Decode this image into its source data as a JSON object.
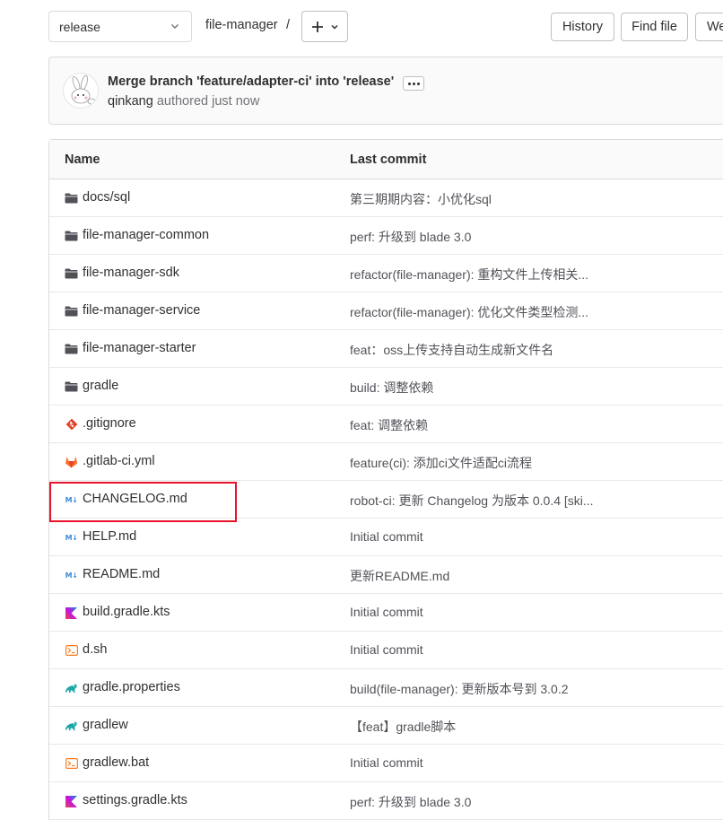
{
  "topbar": {
    "branch": "release",
    "breadcrumb": "file-manager",
    "breadcrumb_sep": "/",
    "history_label": "History",
    "find_file_label": "Find file",
    "web_ide_label": "Web IDE"
  },
  "commit": {
    "title": "Merge branch 'feature/adapter-ci' into 'release'",
    "author": "qinkang",
    "time": " authored just now"
  },
  "table": {
    "col_name": "Name",
    "col_last_commit": "Last commit",
    "rows": [
      {
        "name": "docs/sql",
        "icon": "folder-icon",
        "commit": "第三期期内容：小优化sql"
      },
      {
        "name": "file-manager-common",
        "icon": "folder-icon",
        "commit": "perf: 升级到 blade 3.0"
      },
      {
        "name": "file-manager-sdk",
        "icon": "folder-icon",
        "commit": "refactor(file-manager): 重构文件上传相关..."
      },
      {
        "name": "file-manager-service",
        "icon": "folder-icon",
        "commit": "refactor(file-manager): 优化文件类型检测..."
      },
      {
        "name": "file-manager-starter",
        "icon": "folder-icon",
        "commit": "feat：oss上传支持自动生成新文件名"
      },
      {
        "name": "gradle",
        "icon": "folder-icon",
        "commit": "build: 调整依赖"
      },
      {
        "name": ".gitignore",
        "icon": "git-icon",
        "commit": "feat: 调整依赖"
      },
      {
        "name": ".gitlab-ci.yml",
        "icon": "gitlab-icon",
        "commit": "feature(ci): 添加ci文件适配ci流程"
      },
      {
        "name": "CHANGELOG.md",
        "icon": "markdown-icon",
        "commit": "robot-ci: 更新 Changelog 为版本 0.0.4 [ski..."
      },
      {
        "name": "HELP.md",
        "icon": "markdown-icon",
        "commit": "Initial commit"
      },
      {
        "name": "README.md",
        "icon": "markdown-icon",
        "commit": "更新README.md"
      },
      {
        "name": "build.gradle.kts",
        "icon": "kotlin-icon",
        "commit": "Initial commit"
      },
      {
        "name": "d.sh",
        "icon": "terminal-icon",
        "commit": "Initial commit"
      },
      {
        "name": "gradle.properties",
        "icon": "gradle-icon",
        "commit": "build(file-manager): 更新版本号到 3.0.2"
      },
      {
        "name": "gradlew",
        "icon": "gradle-icon",
        "commit": "【feat】gradle脚本"
      },
      {
        "name": "gradlew.bat",
        "icon": "terminal-icon",
        "commit": "Initial commit"
      },
      {
        "name": "settings.gradle.kts",
        "icon": "kotlin-icon",
        "commit": "perf: 升级到 blade 3.0"
      }
    ]
  },
  "colors": {
    "highlight": "#e8142b",
    "folder": "#535158",
    "git": "#e24329",
    "gitlab": "#fc6d26",
    "markdown": "#3e8bd6",
    "kotlin_start": "#e44857",
    "kotlin_end": "#0095d5",
    "terminal": "#ff7b1c",
    "gradle": "#1ba8a8"
  },
  "highlighted_row": "CHANGELOG.md"
}
